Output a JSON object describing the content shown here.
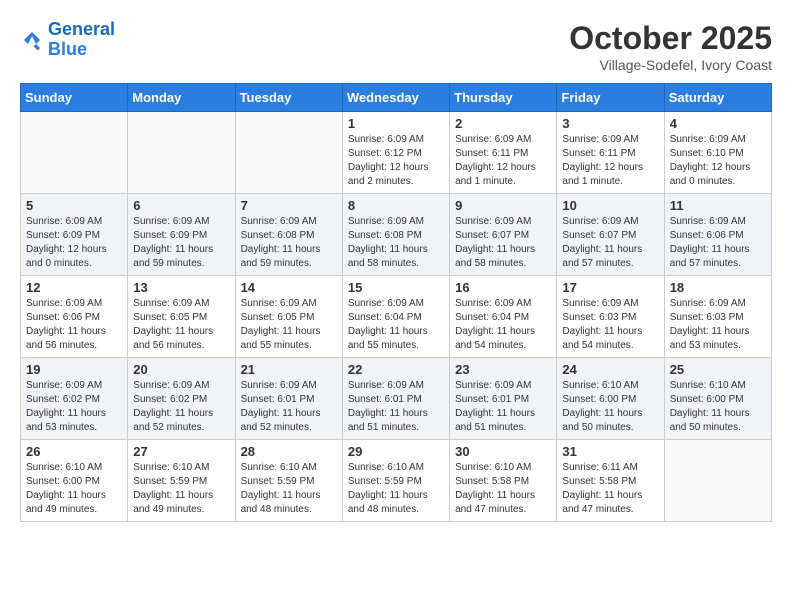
{
  "header": {
    "logo_line1": "General",
    "logo_line2": "Blue",
    "month": "October 2025",
    "location": "Village-Sodefel, Ivory Coast"
  },
  "weekdays": [
    "Sunday",
    "Monday",
    "Tuesday",
    "Wednesday",
    "Thursday",
    "Friday",
    "Saturday"
  ],
  "weeks": [
    [
      {
        "day": "",
        "info": ""
      },
      {
        "day": "",
        "info": ""
      },
      {
        "day": "",
        "info": ""
      },
      {
        "day": "1",
        "info": "Sunrise: 6:09 AM\nSunset: 6:12 PM\nDaylight: 12 hours and 2 minutes."
      },
      {
        "day": "2",
        "info": "Sunrise: 6:09 AM\nSunset: 6:11 PM\nDaylight: 12 hours and 1 minute."
      },
      {
        "day": "3",
        "info": "Sunrise: 6:09 AM\nSunset: 6:11 PM\nDaylight: 12 hours and 1 minute."
      },
      {
        "day": "4",
        "info": "Sunrise: 6:09 AM\nSunset: 6:10 PM\nDaylight: 12 hours and 0 minutes."
      }
    ],
    [
      {
        "day": "5",
        "info": "Sunrise: 6:09 AM\nSunset: 6:09 PM\nDaylight: 12 hours and 0 minutes."
      },
      {
        "day": "6",
        "info": "Sunrise: 6:09 AM\nSunset: 6:09 PM\nDaylight: 11 hours and 59 minutes."
      },
      {
        "day": "7",
        "info": "Sunrise: 6:09 AM\nSunset: 6:08 PM\nDaylight: 11 hours and 59 minutes."
      },
      {
        "day": "8",
        "info": "Sunrise: 6:09 AM\nSunset: 6:08 PM\nDaylight: 11 hours and 58 minutes."
      },
      {
        "day": "9",
        "info": "Sunrise: 6:09 AM\nSunset: 6:07 PM\nDaylight: 11 hours and 58 minutes."
      },
      {
        "day": "10",
        "info": "Sunrise: 6:09 AM\nSunset: 6:07 PM\nDaylight: 11 hours and 57 minutes."
      },
      {
        "day": "11",
        "info": "Sunrise: 6:09 AM\nSunset: 6:06 PM\nDaylight: 11 hours and 57 minutes."
      }
    ],
    [
      {
        "day": "12",
        "info": "Sunrise: 6:09 AM\nSunset: 6:06 PM\nDaylight: 11 hours and 56 minutes."
      },
      {
        "day": "13",
        "info": "Sunrise: 6:09 AM\nSunset: 6:05 PM\nDaylight: 11 hours and 56 minutes."
      },
      {
        "day": "14",
        "info": "Sunrise: 6:09 AM\nSunset: 6:05 PM\nDaylight: 11 hours and 55 minutes."
      },
      {
        "day": "15",
        "info": "Sunrise: 6:09 AM\nSunset: 6:04 PM\nDaylight: 11 hours and 55 minutes."
      },
      {
        "day": "16",
        "info": "Sunrise: 6:09 AM\nSunset: 6:04 PM\nDaylight: 11 hours and 54 minutes."
      },
      {
        "day": "17",
        "info": "Sunrise: 6:09 AM\nSunset: 6:03 PM\nDaylight: 11 hours and 54 minutes."
      },
      {
        "day": "18",
        "info": "Sunrise: 6:09 AM\nSunset: 6:03 PM\nDaylight: 11 hours and 53 minutes."
      }
    ],
    [
      {
        "day": "19",
        "info": "Sunrise: 6:09 AM\nSunset: 6:02 PM\nDaylight: 11 hours and 53 minutes."
      },
      {
        "day": "20",
        "info": "Sunrise: 6:09 AM\nSunset: 6:02 PM\nDaylight: 11 hours and 52 minutes."
      },
      {
        "day": "21",
        "info": "Sunrise: 6:09 AM\nSunset: 6:01 PM\nDaylight: 11 hours and 52 minutes."
      },
      {
        "day": "22",
        "info": "Sunrise: 6:09 AM\nSunset: 6:01 PM\nDaylight: 11 hours and 51 minutes."
      },
      {
        "day": "23",
        "info": "Sunrise: 6:09 AM\nSunset: 6:01 PM\nDaylight: 11 hours and 51 minutes."
      },
      {
        "day": "24",
        "info": "Sunrise: 6:10 AM\nSunset: 6:00 PM\nDaylight: 11 hours and 50 minutes."
      },
      {
        "day": "25",
        "info": "Sunrise: 6:10 AM\nSunset: 6:00 PM\nDaylight: 11 hours and 50 minutes."
      }
    ],
    [
      {
        "day": "26",
        "info": "Sunrise: 6:10 AM\nSunset: 6:00 PM\nDaylight: 11 hours and 49 minutes."
      },
      {
        "day": "27",
        "info": "Sunrise: 6:10 AM\nSunset: 5:59 PM\nDaylight: 11 hours and 49 minutes."
      },
      {
        "day": "28",
        "info": "Sunrise: 6:10 AM\nSunset: 5:59 PM\nDaylight: 11 hours and 48 minutes."
      },
      {
        "day": "29",
        "info": "Sunrise: 6:10 AM\nSunset: 5:59 PM\nDaylight: 11 hours and 48 minutes."
      },
      {
        "day": "30",
        "info": "Sunrise: 6:10 AM\nSunset: 5:58 PM\nDaylight: 11 hours and 47 minutes."
      },
      {
        "day": "31",
        "info": "Sunrise: 6:11 AM\nSunset: 5:58 PM\nDaylight: 11 hours and 47 minutes."
      },
      {
        "day": "",
        "info": ""
      }
    ]
  ]
}
